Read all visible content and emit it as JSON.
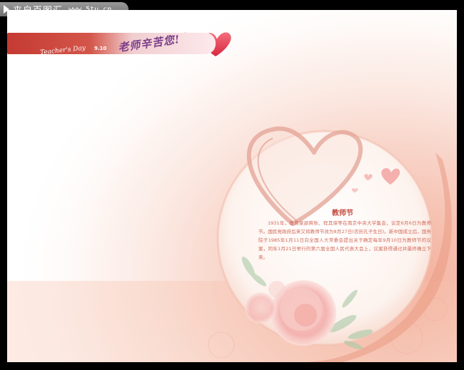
{
  "watermark": {
    "site_name": "来自百图汇",
    "url": "www.5tu.cn"
  },
  "banner": {
    "teachers_day": "Teacher's Day",
    "date": "9.10",
    "greeting": "老师辛苦您!"
  },
  "article": {
    "title": "教师节",
    "body": "1931年，教育家邰爽秋、程其保等在南京中央大学集会，议定6月6日为教师节。国民党政府后来又将教师节改为8月27日(农历孔子生日)。新中国成立后，国务院于1985年1月11日向全国人大常委会提出关于确定每年9月10日为教师节的议案，同年1月21日举行的第六届全国人民代表大会上，议案获得通过并最终确立下来。"
  },
  "colors": {
    "frame": "#000000",
    "page": "#ffffff",
    "banner_red": "#c43a32",
    "heart_pink": "#e8607a",
    "petal_peach": "#f4b8a8",
    "text_red": "#c24a3e",
    "greeting_purple": "#7a3e8a"
  }
}
